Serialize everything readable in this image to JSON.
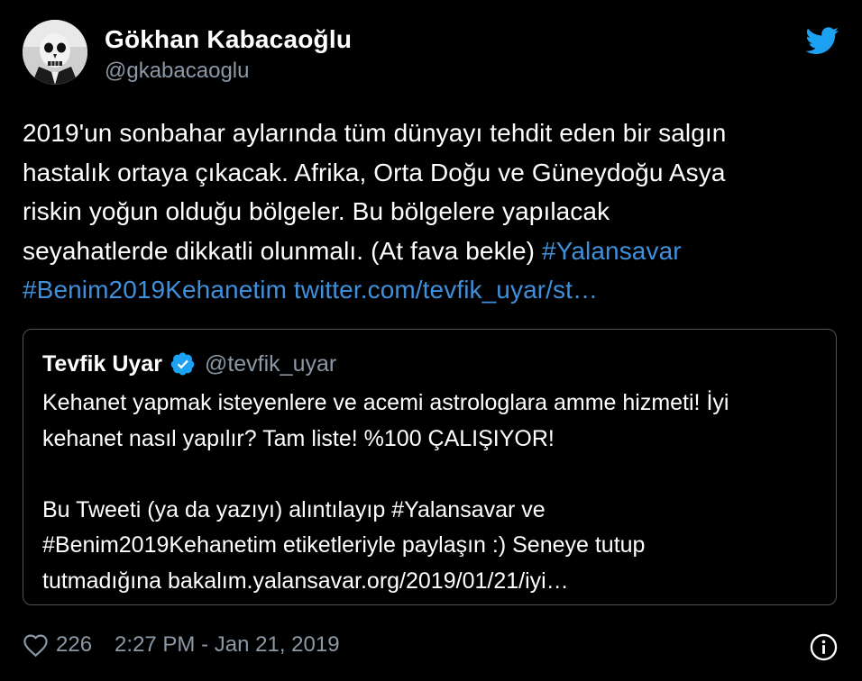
{
  "author": {
    "display_name": "Gökhan Kabacaoğlu",
    "handle": "@gkabacaoglu",
    "avatar_icon": "skull-avatar"
  },
  "brand": {
    "icon": "twitter-bird-icon",
    "color": "#1da1f2"
  },
  "tweet": {
    "lines": [
      "2019'un sonbahar aylarında tüm dünyayı tehdit eden bir salgın",
      "hastalık ortaya çıkacak. Afrika, Orta Doğu ve Güneydoğu Asya",
      "riskin yoğun olduğu bölgeler. Bu bölgelere yapılacak"
    ],
    "line4_text": "seyahatlerde dikkatli olunmalı. (At fava bekle) ",
    "hashtag_1": "#Yalansavar",
    "hashtag_2": "#Benim2019Kehanetim",
    "link": "twitter.com/tevfik_uyar/st…",
    "link_color": "#3f90dc"
  },
  "quoted_tweet": {
    "display_name": "Tevfik Uyar",
    "verified_icon": "verified-badge-icon",
    "handle": "@tevfik_uyar",
    "lines": [
      "Kehanet yapmak isteyenlere ve acemi astrologlara amme hizmeti!  İyi",
      "kehanet nasıl yapılır? Tam liste! %100 ÇALIŞIYOR!",
      "",
      "Bu Tweeti (ya da yazıyı) alıntılayıp #Yalansavar ve",
      "#Benim2019Kehanetim etiketleriyle paylaşın :) Seneye tutup",
      "tutmadığına bakalım.yalansavar.org/2019/01/21/iyi…"
    ]
  },
  "footer": {
    "like_icon": "heart-icon",
    "like_count": "226",
    "timestamp": "2:27 PM - Jan 21, 2019",
    "info_icon": "info-icon"
  }
}
